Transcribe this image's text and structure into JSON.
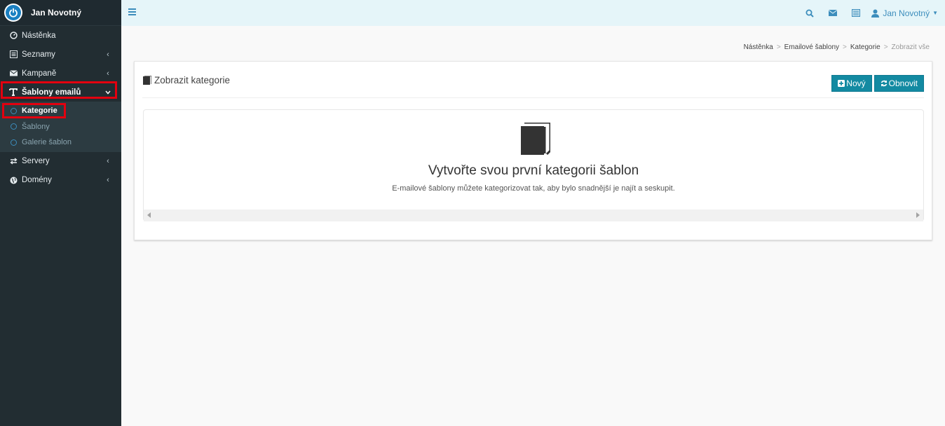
{
  "brand": {
    "user_name": "Jan Novotný",
    "logo_icon": "power-icon"
  },
  "sidebar": {
    "items": [
      {
        "label": "Nástěnka",
        "icon": "dashboard-icon",
        "has_arrow": false
      },
      {
        "label": "Seznamy",
        "icon": "list-icon",
        "has_arrow": true
      },
      {
        "label": "Kampaně",
        "icon": "envelope-icon",
        "has_arrow": true
      },
      {
        "label": "Šablony emailů",
        "icon": "text-icon",
        "expanded": true
      },
      {
        "label": "Servery",
        "icon": "exchange-icon",
        "has_arrow": true
      },
      {
        "label": "Domény",
        "icon": "globe-icon",
        "has_arrow": true
      }
    ],
    "subitems": [
      {
        "label": "Kategorie",
        "active": true
      },
      {
        "label": "Šablony"
      },
      {
        "label": "Galerie šablon"
      }
    ]
  },
  "topbar": {
    "menu_icon": "hamburger-icon",
    "icons": [
      "search-icon",
      "envelope-icon",
      "list-alt-icon"
    ],
    "user_label": "Jan Novotný"
  },
  "breadcrumb": [
    "Nástěnka",
    "Emailové šablony",
    "Kategorie",
    "Zobrazit vše"
  ],
  "box": {
    "title": "Zobrazit kategorie",
    "buttons": {
      "new_label": "Nový",
      "refresh_label": "Obnovit"
    },
    "empty": {
      "title": "Vytvořte svou první kategorii šablon",
      "subtitle": "E-mailové šablony můžete kategorizovat tak, aby bylo snadnější je najít a seskupit."
    }
  },
  "colors": {
    "accent": "#138aa2",
    "sidebar_bg": "#222d32",
    "highlight": "#e3000f",
    "link": "#3c8dbc"
  }
}
